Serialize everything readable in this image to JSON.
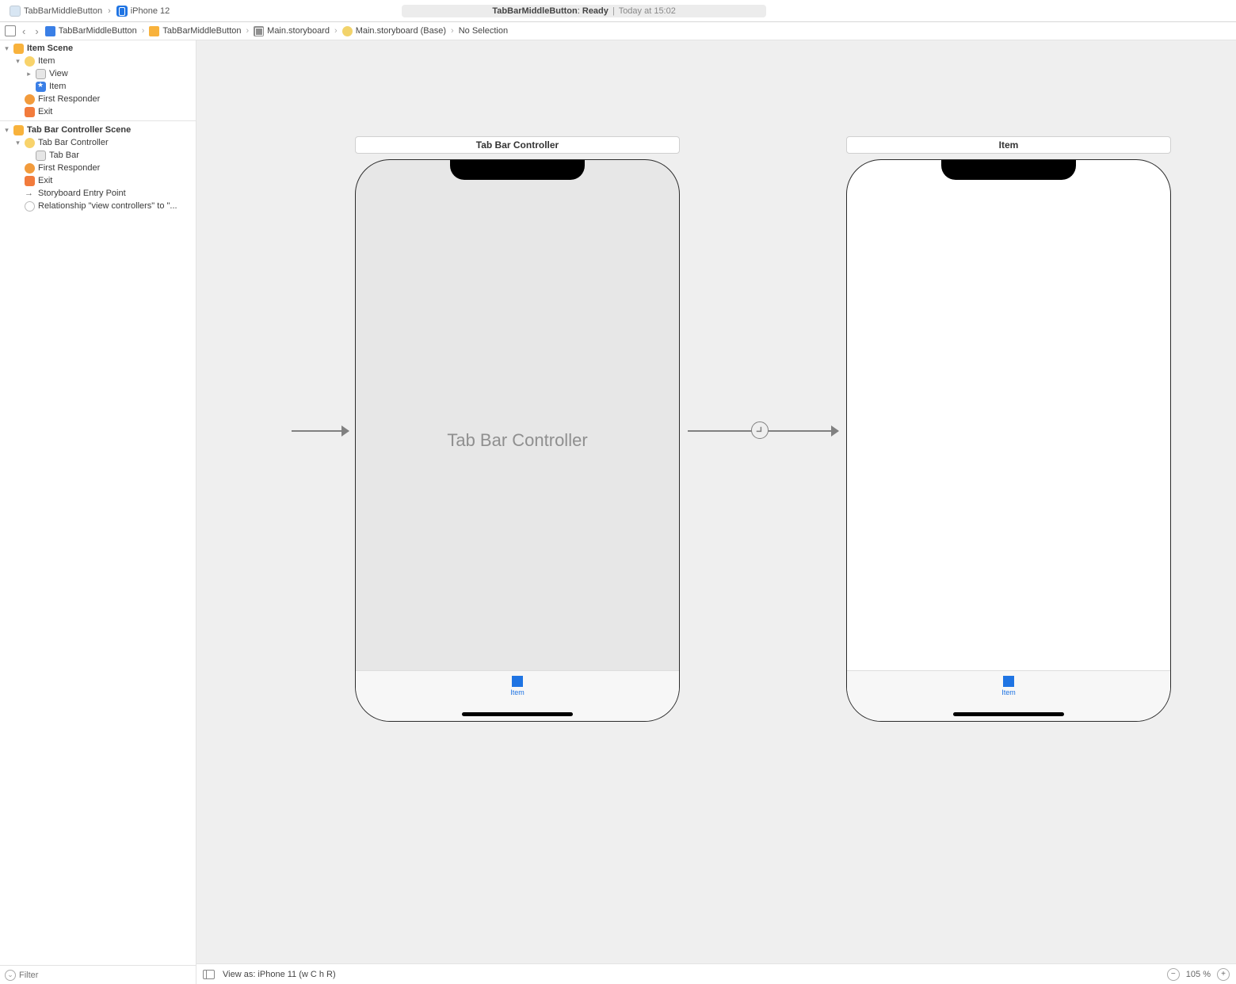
{
  "toolbar": {
    "scheme_app": "TabBarMiddleButton",
    "scheme_device": "iPhone 12",
    "status_project": "TabBarMiddleButton",
    "status_state": "Ready",
    "status_time": "Today at 15:02"
  },
  "jumpbar": {
    "crumbs": [
      {
        "label": "TabBarMiddleButton"
      },
      {
        "label": "TabBarMiddleButton"
      },
      {
        "label": "Main.storyboard"
      },
      {
        "label": "Main.storyboard (Base)"
      },
      {
        "label": "No Selection"
      }
    ]
  },
  "navigator": {
    "scenes": [
      {
        "label": "Item Scene",
        "children": [
          {
            "label": "Item",
            "icon": "vc",
            "children": [
              {
                "label": "View",
                "icon": "view"
              },
              {
                "label": "Item",
                "icon": "star"
              }
            ]
          },
          {
            "label": "First Responder",
            "icon": "first"
          },
          {
            "label": "Exit",
            "icon": "exit"
          }
        ]
      },
      {
        "label": "Tab Bar Controller Scene",
        "children": [
          {
            "label": "Tab Bar Controller",
            "icon": "vc",
            "children": [
              {
                "label": "Tab Bar",
                "icon": "tabbar"
              }
            ]
          },
          {
            "label": "First Responder",
            "icon": "first"
          },
          {
            "label": "Exit",
            "icon": "exit"
          },
          {
            "label": "Storyboard Entry Point",
            "icon": "entry"
          },
          {
            "label": "Relationship \"view controllers\" to \"...",
            "icon": "rel"
          }
        ]
      }
    ],
    "filter_placeholder": "Filter"
  },
  "canvas": {
    "scene1": {
      "title": "Tab Bar Controller",
      "centerlabel": "Tab Bar Controller",
      "tab_label": "Item"
    },
    "scene2": {
      "title": "Item",
      "tab_label": "Item"
    }
  },
  "bottombar": {
    "view_as": "View as: iPhone 11 (w C  h R)",
    "zoom": "105 %"
  }
}
